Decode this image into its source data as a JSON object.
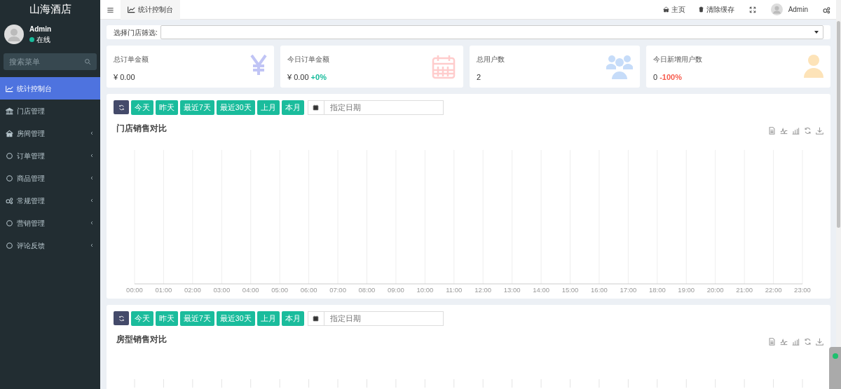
{
  "brand": "山海酒店",
  "user": {
    "name": "Admin",
    "status": "在线",
    "online": true
  },
  "sidebar": {
    "search_placeholder": "搜索菜单",
    "items": [
      {
        "label": "统计控制台",
        "selected": true,
        "has_submenu": false
      },
      {
        "label": "门店管理",
        "selected": false,
        "has_submenu": false
      },
      {
        "label": "房间管理",
        "selected": false,
        "has_submenu": true
      },
      {
        "label": "订单管理",
        "selected": false,
        "has_submenu": true
      },
      {
        "label": "商品管理",
        "selected": false,
        "has_submenu": true
      },
      {
        "label": "常规管理",
        "selected": false,
        "has_submenu": true
      },
      {
        "label": "营销管理",
        "selected": false,
        "has_submenu": true
      },
      {
        "label": "评论反馈",
        "selected": false,
        "has_submenu": true
      }
    ]
  },
  "topbar": {
    "tabs": [
      {
        "label": "统计控制台",
        "selected": true
      }
    ],
    "links": [
      "主页",
      "清除缓存"
    ],
    "user": "Admin"
  },
  "filter": {
    "label": "选择门店筛选:"
  },
  "stats": [
    {
      "label": "总订单金额",
      "value": "¥ 0.00"
    },
    {
      "label": "今日订单金额",
      "value": "¥ 0.00",
      "delta": "+0%",
      "color": "#18bc9c"
    },
    {
      "label": "总用户数",
      "value": "2"
    },
    {
      "label": "今日新增用户数",
      "value": "0",
      "delta": "-100%",
      "color": "#f75d4f"
    }
  ],
  "panels": [
    {
      "title": "门店销售对比",
      "ranges": [
        "今天",
        "昨天",
        "最近7天",
        "最近30天",
        "上月",
        "本月"
      ],
      "date_placeholder": "指定日期",
      "chart": {
        "x_labels": [
          "00:00",
          "01:00",
          "02:00",
          "03:00",
          "04:00",
          "05:00",
          "06:00",
          "07:00",
          "08:00",
          "09:00",
          "10:00",
          "11:00",
          "12:00",
          "13:00",
          "14:00",
          "15:00",
          "16:00",
          "17:00",
          "18:00",
          "19:00",
          "20:00",
          "21:00",
          "22:00",
          "23:00"
        ]
      }
    },
    {
      "title": "房型销售对比",
      "ranges": [
        "今天",
        "昨天",
        "最近7天",
        "最近30天",
        "上月",
        "本月"
      ],
      "date_placeholder": "指定日期"
    }
  ]
}
